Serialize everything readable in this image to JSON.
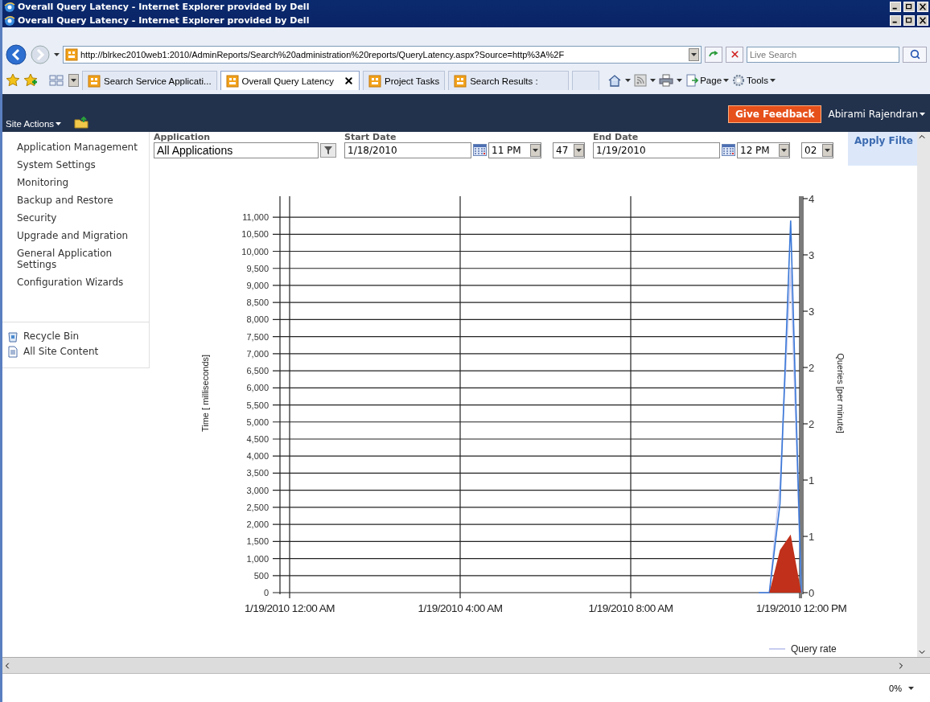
{
  "window": {
    "title_lines": [
      "Overall Query Latency - Internet Explorer provided by Dell",
      "Overall Query Latency - Internet Explorer provided by Dell"
    ]
  },
  "address_bar": {
    "url": "http://blrkec2010web1:2010/AdminReports/Search%20administration%20reports/QueryLatency.aspx?Source=http%3A%2F",
    "search_placeholder": "Live Search"
  },
  "tabs": [
    {
      "label": "Search Service Applicati...",
      "selected": false
    },
    {
      "label": "Overall Query Latency",
      "selected": true
    },
    {
      "label": "Project Tasks",
      "selected": false
    },
    {
      "label": "Search Results :",
      "selected": false
    }
  ],
  "command_bar": [
    "Page",
    "Tools"
  ],
  "ribbon": {
    "site_actions": "Site Actions",
    "feedback": "Give Feedback",
    "user": "Abirami Rajendran"
  },
  "sidebar": {
    "items": [
      "Application Management",
      "System Settings",
      "Monitoring",
      "Backup and Restore",
      "Security",
      "Upgrade and Migration",
      "General Application Settings",
      "Configuration Wizards"
    ],
    "footer_items": [
      {
        "kind": "recycle",
        "label": "Recycle Bin"
      },
      {
        "kind": "document",
        "label": "All Site Content"
      }
    ]
  },
  "filters": {
    "application": {
      "label": "Application",
      "value": "All Applications"
    },
    "start_date": {
      "label": "Start Date",
      "date": "1/18/2010",
      "hour": "11 PM",
      "minute": "47"
    },
    "end_date": {
      "label": "End Date",
      "date": "1/19/2010",
      "hour": "12 PM",
      "minute": "02"
    },
    "apply": "Apply Filte"
  },
  "chart": {
    "chart_data": {
      "type": "line",
      "grid": true,
      "ylabel": "Time [ milliseconds]",
      "y2label": "Queries [per minute]",
      "ylim": [
        0,
        11614
      ],
      "y2lim": [
        0,
        4
      ],
      "categories": [
        "1/19/2010 12:00 AM",
        null,
        null,
        null,
        null,
        null,
        null,
        null,
        null,
        null,
        null,
        null,
        null,
        null,
        null,
        null,
        "1/19/2010 4:00 AM",
        null,
        null,
        null,
        null,
        null,
        null,
        null,
        null,
        null,
        null,
        null,
        null,
        null,
        null,
        null,
        "1/19/2010 8:00 AM",
        null,
        null,
        null,
        null,
        null,
        null,
        null,
        null,
        null,
        null,
        null,
        null,
        null,
        null,
        null,
        "1/19/2010 12:00 PM"
      ],
      "yticks": [
        {
          "value": 0,
          "label": "0"
        },
        {
          "value": 500,
          "label": "500"
        },
        {
          "value": 1000,
          "label": "1,000"
        },
        {
          "value": 1500,
          "label": "1,500"
        },
        {
          "value": 2000,
          "label": "2,000"
        },
        {
          "value": 2500,
          "label": "2,500"
        },
        {
          "value": 3000,
          "label": "3,000"
        },
        {
          "value": 3500,
          "label": "3,500"
        },
        {
          "value": 4000,
          "label": "4,000"
        },
        {
          "value": 4500,
          "label": "4,500"
        },
        {
          "value": 5000,
          "label": "5,000"
        },
        {
          "value": 5500,
          "label": "5,500"
        },
        {
          "value": 6000,
          "label": "6,000"
        },
        {
          "value": 6500,
          "label": "6,500"
        },
        {
          "value": 7000,
          "label": "7,000"
        },
        {
          "value": 7500,
          "label": "7,500"
        },
        {
          "value": 8000,
          "label": "8,000"
        },
        {
          "value": 8500,
          "label": "8,500"
        },
        {
          "value": 9000,
          "label": "9,000"
        },
        {
          "value": 9500,
          "label": "9,500"
        },
        {
          "value": 10000,
          "label": "10,000"
        },
        {
          "value": 10500,
          "label": "10,500"
        },
        {
          "value": 11000,
          "label": "11,000"
        }
      ],
      "y2ticks": [
        {
          "value": 0,
          "label": "0"
        },
        {
          "value": 0.571,
          "label": "1"
        },
        {
          "value": 1.143,
          "label": "1"
        },
        {
          "value": 1.714,
          "label": "2"
        },
        {
          "value": 2.286,
          "label": "2"
        },
        {
          "value": 2.857,
          "label": "3"
        },
        {
          "value": 3.429,
          "label": "3"
        },
        {
          "value": 4,
          "label": "4"
        }
      ],
      "series": [
        {
          "name": "Query rate",
          "color": "#c8cdf0",
          "axis": "y2",
          "values": [
            null,
            null,
            null,
            null,
            null,
            null,
            null,
            null,
            null,
            null,
            null,
            null,
            null,
            null,
            null,
            null,
            null,
            null,
            null,
            null,
            null,
            null,
            null,
            null,
            null,
            null,
            null,
            null,
            null,
            null,
            null,
            null,
            null,
            null,
            null,
            null,
            null,
            null,
            null,
            null,
            null,
            null,
            null,
            null,
            0,
            0,
            1.1,
            3.3,
            0
          ]
        },
        {
          "color": "#3a78d8",
          "values": [
            null,
            null,
            null,
            null,
            null,
            null,
            null,
            null,
            null,
            null,
            null,
            null,
            null,
            null,
            null,
            null,
            null,
            null,
            null,
            null,
            null,
            null,
            null,
            null,
            null,
            null,
            null,
            null,
            null,
            null,
            null,
            null,
            null,
            null,
            null,
            null,
            null,
            null,
            null,
            null,
            null,
            null,
            null,
            null,
            0,
            0,
            2600,
            10900,
            0
          ]
        },
        {
          "color": "#c0301a",
          "type": "area",
          "values": [
            null,
            null,
            null,
            null,
            null,
            null,
            null,
            null,
            null,
            null,
            null,
            null,
            null,
            null,
            null,
            null,
            null,
            null,
            null,
            null,
            null,
            null,
            null,
            null,
            null,
            null,
            null,
            null,
            null,
            null,
            null,
            null,
            null,
            null,
            null,
            null,
            null,
            null,
            null,
            null,
            null,
            null,
            null,
            null,
            0,
            0,
            1250,
            1700,
            0
          ]
        }
      ]
    }
  },
  "status_bar": {
    "zoom": "0%"
  }
}
